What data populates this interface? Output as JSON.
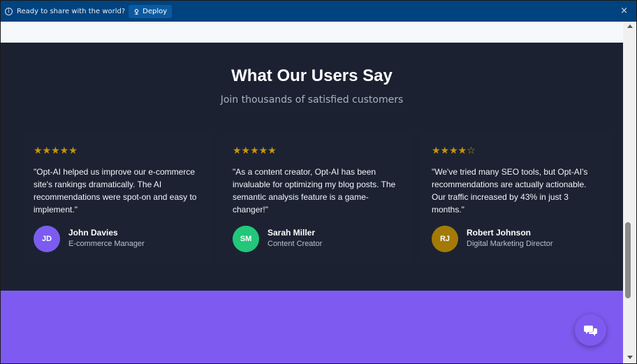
{
  "banner": {
    "message": "Ready to share with the world?",
    "deploy_label": "Deploy",
    "info_icon": "i",
    "close_icon": "×"
  },
  "testimonials": {
    "title": "What Our Users Say",
    "subtitle": "Join thousands of satisfied customers",
    "items": [
      {
        "stars": "★★★★★",
        "rating": 5,
        "quote": "\"Opt-AI helped us improve our e-commerce site's rankings dramatically. The AI recommendations were spot-on and easy to implement.\"",
        "initials": "JD",
        "name": "John Davies",
        "role": "E-commerce Manager",
        "avatar_color": "#7b5cf0"
      },
      {
        "stars": "★★★★★",
        "rating": 5,
        "quote": "\"As a content creator, Opt-AI has been invaluable for optimizing my blog posts. The semantic analysis feature is a game-changer!\"",
        "initials": "SM",
        "name": "Sarah Miller",
        "role": "Content Creator",
        "avatar_color": "#22c77a"
      },
      {
        "stars": "★★★★☆",
        "rating": 4.5,
        "quote": "\"We've tried many SEO tools, but Opt-AI's recommendations are actually actionable. Our traffic increased by 43% in just 3 months.\"",
        "initials": "RJ",
        "name": "Robert Johnson",
        "role": "Digital Marketing Director",
        "avatar_color": "#a47a06"
      }
    ]
  },
  "colors": {
    "banner_bg": "#00437f",
    "section_bg": "#1b2131",
    "star": "#c7950a",
    "purple": "#7f5af0"
  },
  "icons": {
    "chat": "chat-bubbles-icon",
    "deploy": "deploy-icon"
  }
}
